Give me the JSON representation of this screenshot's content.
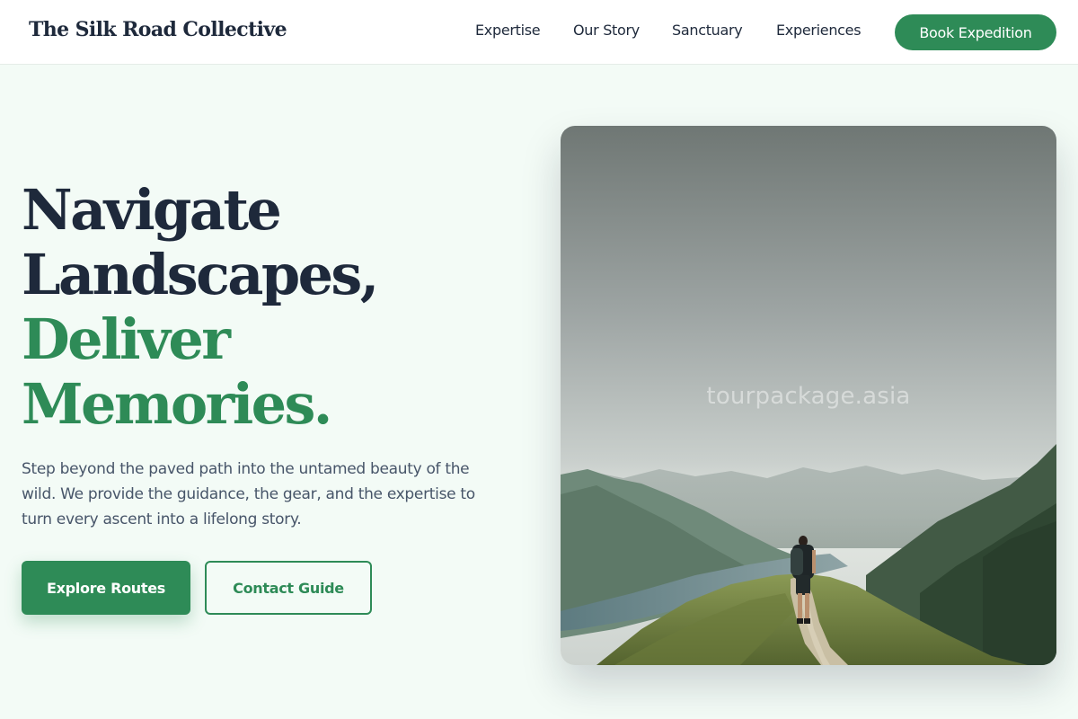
{
  "header": {
    "logo": "The Silk Road Collective",
    "nav": [
      "Expertise",
      "Our Story",
      "Sanctuary",
      "Experiences"
    ],
    "cta": "Book Expedition"
  },
  "hero": {
    "title_lines": [
      "Navigate",
      "Landscapes,"
    ],
    "accent_lines": [
      "Deliver",
      "Memories."
    ],
    "description": "Step beyond the paved path into the untamed beauty of the wild. We provide the guidance, the gear, and the expertise to turn every ascent into a lifelong story.",
    "primary_button": "Explore Routes",
    "secondary_button": "Contact Guide"
  },
  "image": {
    "subject": "hiker on mountain ridge trail above a lake valley",
    "watermark": "tourpackage.asia"
  },
  "colors": {
    "accent": "#2e8b57",
    "dark": "#1e293b",
    "background": "#f3fbf6"
  }
}
